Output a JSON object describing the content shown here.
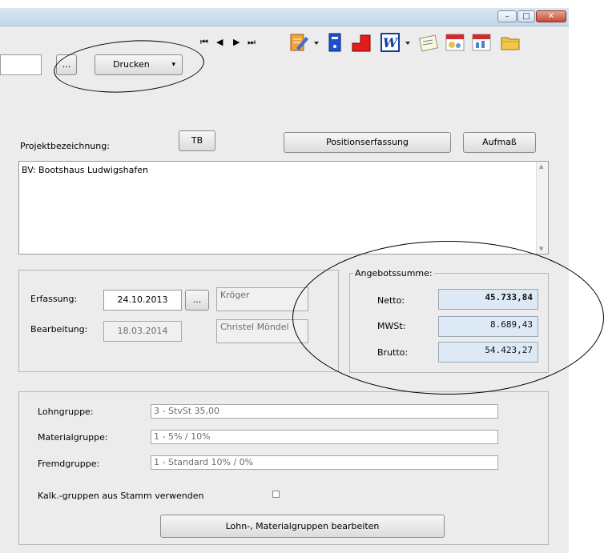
{
  "toolbar": {
    "browse_label": "...",
    "print_label": "Drucken",
    "print_arrow": "▾",
    "nav_first": "⏮",
    "nav_prev": "◀",
    "nav_next": "▶",
    "nav_last": "⏭"
  },
  "project": {
    "label": "Projektbezeichnung:",
    "tb_button": "TB",
    "positions_button": "Positionserfassung",
    "aufmass_button": "Aufmaß",
    "description": "BV: Bootshaus Ludwigshafen"
  },
  "dates": {
    "erfassung_label": "Erfassung:",
    "erfassung_value": "24.10.2013",
    "erfassung_browse": "...",
    "erfassung_user": "Kröger",
    "bearbeitung_label": "Bearbeitung:",
    "bearbeitung_value": "18.03.2014",
    "bearbeitung_user": "Christel Möndel"
  },
  "sums": {
    "title": "Angebotssumme:",
    "netto_label": "Netto:",
    "netto_value": "45.733,84",
    "mwst_label": "MWSt:",
    "mwst_value": "8.689,43",
    "brutto_label": "Brutto:",
    "brutto_value": "54.423,27"
  },
  "groups": {
    "lohn_label": "Lohngruppe:",
    "lohn_value": "3 - StvSt 35,00",
    "material_label": "Materialgruppe:",
    "material_value": "1 - 5% / 10%",
    "fremd_label": "Fremdgruppe:",
    "fremd_value": "1 - Standard 10% / 0%",
    "stamm_label": "Kalk.-gruppen aus Stamm verwenden",
    "stamm_checked": false,
    "edit_button": "Lohn-, Materialgruppen bearbeiten"
  },
  "window": {
    "min_glyph": "–",
    "max_glyph": "□",
    "close_glyph": "✕"
  },
  "colors": {
    "sum_field_bg": "#ddeaf6",
    "titlebar": "#c4d7ec",
    "close_button": "#c74a2f"
  }
}
